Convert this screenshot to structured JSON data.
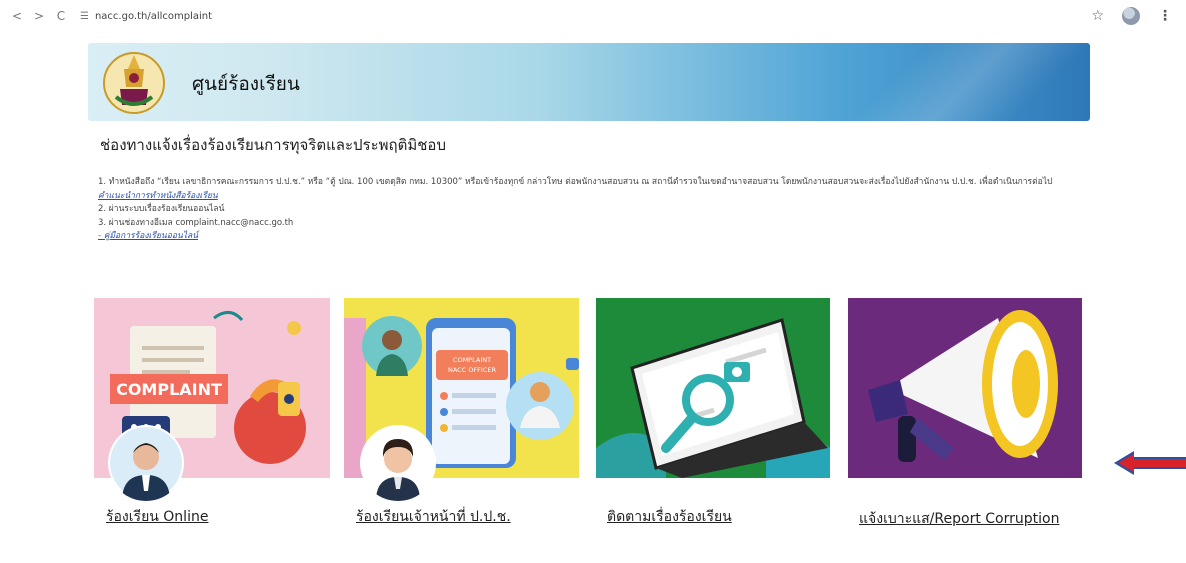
{
  "browser": {
    "back_icon": "<",
    "forward_icon": ">",
    "reload_icon": "C",
    "url": "nacc.go.th/allcomplaint"
  },
  "banner": {
    "title": "ศูนย์ร้องเรียน"
  },
  "page": {
    "heading": "ช่องทางแจ้งเรื่องร้องเรียนการทุจริตและประพฤติมิชอบ",
    "step1": "1. ทำหนังสือถึง “เรียน เลขาธิการคณะกรรมการ ป.ป.ช.” หรือ “ตู้ ปณ. 100 เขตดุสิต กทม. 10300” หรือเข้าร้องทุกข์ กล่าวโทษ ต่อพนักงานสอบสวน ณ สถานีตำรวจในเขตอำนาจสอบสวน โดยพนักงานสอบสวนจะส่งเรื่องไปยังสำนักงาน ป.ป.ช. เพื่อดำเนินการต่อไป",
    "step1_link": "คำแนะนำการทำหนังสือร้องเรียน",
    "step2": "2. ผ่านระบบเรื่องร้องเรียนออนไลน์",
    "step3": "3. ผ่านช่องทางอีเมล complaint.nacc@nacc.go.th",
    "manual_link": "- คู่มือการร้องเรียนออนไลน์"
  },
  "cards": {
    "c1": {
      "label": "ร้องเรียน Online",
      "image_text": "COMPLAINT"
    },
    "c2": {
      "label": "ร้องเรียนเจ้าหน้าที่ ป.ป.ช.",
      "image_text_1": "COMPLAINT",
      "image_text_2": "NACC OFFICER"
    },
    "c3": {
      "label": "ติดตามเรื่องร้องเรียน"
    },
    "c4": {
      "label": "แจ้งเบาะแส/Report Corruption"
    }
  },
  "colors": {
    "link": "#2a4fa8",
    "arrow_red": "#d8232a",
    "arrow_blue": "#2f4fa0"
  }
}
